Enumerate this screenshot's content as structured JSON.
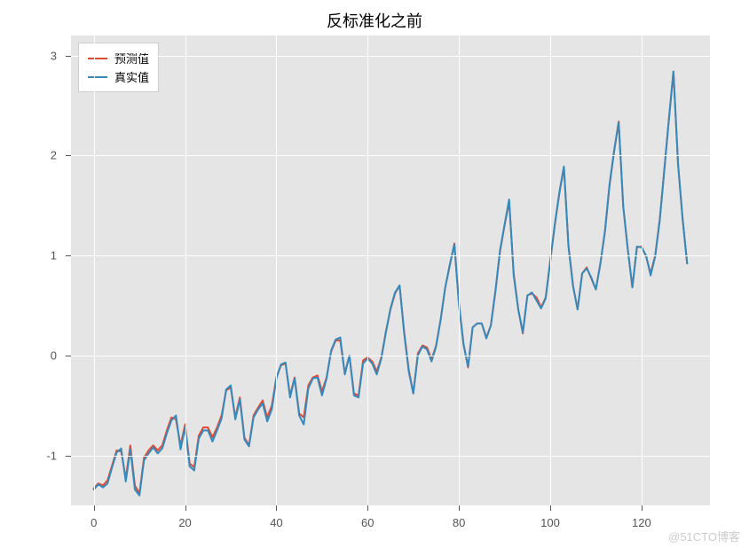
{
  "chart_data": {
    "type": "line",
    "title": "反标准化之前",
    "xlabel": "",
    "ylabel": "",
    "xlim": [
      -5,
      135
    ],
    "ylim": [
      -1.5,
      3.2
    ],
    "xticks": [
      0,
      20,
      40,
      60,
      80,
      100,
      120
    ],
    "yticks": [
      -1,
      0,
      1,
      2,
      3
    ],
    "series": [
      {
        "name": "预测值",
        "color": "#e24a33",
        "values": [
          -1.33,
          -1.28,
          -1.3,
          -1.25,
          -1.1,
          -0.95,
          -0.96,
          -1.23,
          -0.9,
          -1.3,
          -1.38,
          -1.02,
          -0.95,
          -0.9,
          -0.95,
          -0.9,
          -0.75,
          -0.62,
          -0.64,
          -0.9,
          -0.69,
          -1.08,
          -1.12,
          -0.8,
          -0.72,
          -0.72,
          -0.82,
          -0.72,
          -0.6,
          -0.35,
          -0.32,
          -0.62,
          -0.42,
          -0.82,
          -0.9,
          -0.6,
          -0.52,
          -0.45,
          -0.62,
          -0.5,
          -0.22,
          -0.1,
          -0.08,
          -0.4,
          -0.22,
          -0.58,
          -0.62,
          -0.3,
          -0.22,
          -0.2,
          -0.36,
          -0.22,
          0.04,
          0.15,
          0.15,
          -0.18,
          0.0,
          -0.38,
          -0.4,
          -0.05,
          -0.02,
          -0.06,
          -0.16,
          -0.02,
          0.24,
          0.46,
          0.62,
          0.7,
          0.24,
          -0.14,
          -0.38,
          0.02,
          0.1,
          0.08,
          -0.04,
          0.1,
          0.36,
          0.68,
          0.9,
          1.12,
          0.52,
          0.12,
          -0.12,
          0.28,
          0.32,
          0.32,
          0.18,
          0.3,
          0.64,
          1.04,
          1.3,
          1.54,
          0.82,
          0.46,
          0.22,
          0.6,
          0.62,
          0.58,
          0.48,
          0.58,
          0.94,
          1.3,
          1.62,
          1.88,
          1.1,
          0.7,
          0.46,
          0.82,
          0.88,
          0.77,
          0.66,
          0.92,
          1.24,
          1.7,
          2.04,
          2.34,
          1.49,
          1.06,
          0.68,
          1.08,
          1.09,
          0.99,
          0.82,
          1.0,
          1.36,
          1.86,
          2.36,
          2.84,
          1.92,
          1.37,
          0.92
        ]
      },
      {
        "name": "真实值",
        "color": "#348abd",
        "values": [
          -1.34,
          -1.29,
          -1.32,
          -1.28,
          -1.12,
          -0.97,
          -0.93,
          -1.26,
          -0.94,
          -1.34,
          -1.4,
          -1.05,
          -0.98,
          -0.92,
          -0.98,
          -0.93,
          -0.78,
          -0.65,
          -0.6,
          -0.94,
          -0.72,
          -1.11,
          -1.15,
          -0.83,
          -0.75,
          -0.75,
          -0.86,
          -0.75,
          -0.63,
          -0.34,
          -0.3,
          -0.64,
          -0.44,
          -0.84,
          -0.91,
          -0.62,
          -0.54,
          -0.48,
          -0.66,
          -0.54,
          -0.23,
          -0.09,
          -0.07,
          -0.42,
          -0.23,
          -0.6,
          -0.69,
          -0.33,
          -0.23,
          -0.22,
          -0.4,
          -0.23,
          0.05,
          0.16,
          0.18,
          -0.19,
          0.0,
          -0.4,
          -0.42,
          -0.08,
          -0.03,
          -0.08,
          -0.19,
          -0.03,
          0.23,
          0.47,
          0.63,
          0.7,
          0.22,
          -0.16,
          -0.38,
          0.0,
          0.09,
          0.06,
          -0.06,
          0.09,
          0.36,
          0.68,
          0.91,
          1.11,
          0.51,
          0.11,
          -0.11,
          0.28,
          0.32,
          0.32,
          0.17,
          0.3,
          0.65,
          1.05,
          1.31,
          1.56,
          0.8,
          0.46,
          0.23,
          0.6,
          0.63,
          0.55,
          0.47,
          0.57,
          0.94,
          1.31,
          1.63,
          1.89,
          1.09,
          0.69,
          0.46,
          0.82,
          0.87,
          0.78,
          0.66,
          0.92,
          1.25,
          1.71,
          2.05,
          2.33,
          1.49,
          1.06,
          0.68,
          1.09,
          1.08,
          1.0,
          0.8,
          0.99,
          1.35,
          1.85,
          2.36,
          2.84,
          1.92,
          1.37,
          0.92
        ]
      }
    ]
  },
  "legend": {
    "items": [
      {
        "label": "预测值",
        "color": "#e24a33"
      },
      {
        "label": "真实值",
        "color": "#348abd"
      }
    ]
  },
  "watermark": "@51CTO博客"
}
